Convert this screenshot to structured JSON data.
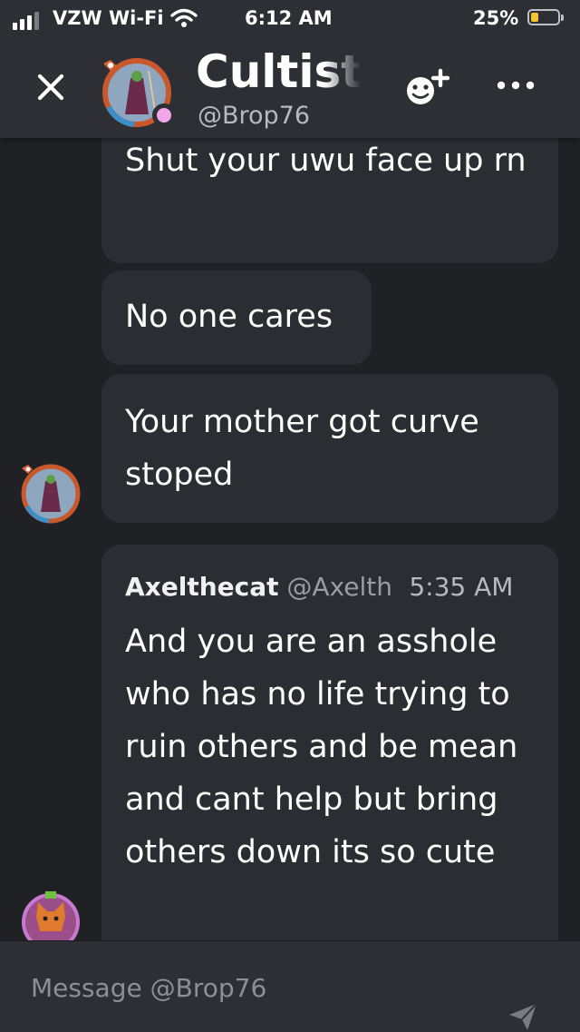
{
  "status_bar": {
    "carrier": "VZW Wi-Fi",
    "time": "6:12 AM",
    "battery_percent": "25%",
    "battery_level": 0.25,
    "icons": [
      "signal-icon",
      "wifi-icon",
      "battery-icon"
    ]
  },
  "header": {
    "title": "Cultist",
    "handle": "@Brop76",
    "presence_color": "#f4a7e8",
    "icons": [
      "close-icon",
      "add-friend-icon",
      "more-icon"
    ]
  },
  "messages": [
    {
      "text": "Shut your uwu face up rn"
    },
    {
      "text": "No one cares"
    },
    {
      "text": "Your mother got curve stoped"
    },
    {
      "reply_author": "Axelthecat",
      "reply_handle": "@Axelth",
      "reply_time": "5:35 AM",
      "text": "And you are an asshole who has no life trying to ruin others and be mean and cant help but bring others down its so cute"
    }
  ],
  "composer": {
    "placeholder": "Message @Brop76",
    "value": "",
    "icons": [
      "send-icon"
    ]
  },
  "colors": {
    "background": "#202124",
    "panel": "#2d2f35",
    "bubble": "#2c2d33",
    "battery": "#f4c531"
  }
}
